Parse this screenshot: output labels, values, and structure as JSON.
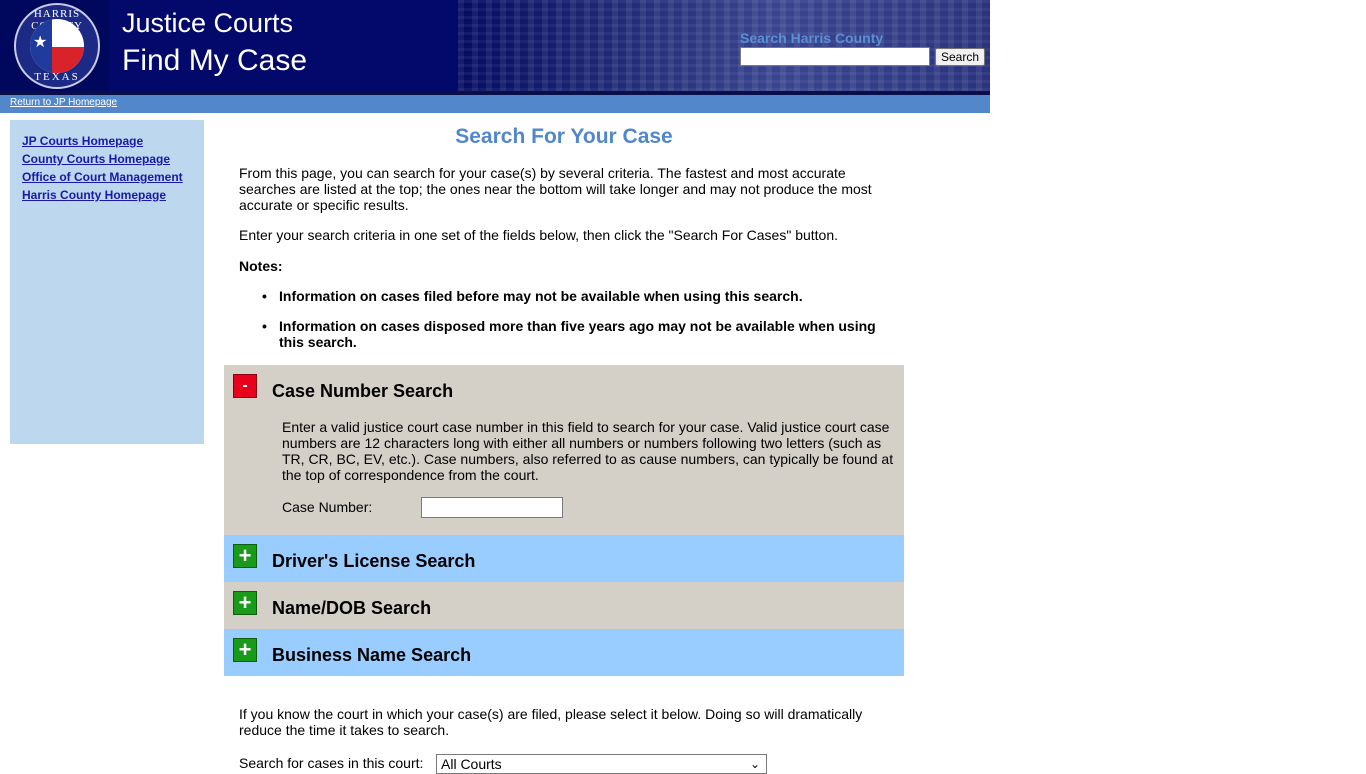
{
  "header": {
    "seal": {
      "top_text": "HARRIS COUNTY",
      "bottom_text": "TEXAS"
    },
    "title_line1": "Justice Courts",
    "title_line2": "Find My Case",
    "search_label": "Search Harris County",
    "search_value": "",
    "search_button": "Search"
  },
  "nav": {
    "return_link": "Return to JP Homepage"
  },
  "sidebar": {
    "items": [
      {
        "label": "JP Courts Homepage"
      },
      {
        "label": "County Courts Homepage"
      },
      {
        "label": "Office of Court Management"
      },
      {
        "label": "Harris County Homepage"
      }
    ]
  },
  "main": {
    "title": "Search For Your Case",
    "intro": "From this page, you can search for your case(s) by several criteria. The fastest and most accurate searches are listed at the top; the ones near the bottom will take longer and may not produce the most accurate or specific results.",
    "instruction": "Enter your search criteria in one set of the fields below, then click the \"Search For Cases\" button.",
    "notes_title": "Notes:",
    "notes": [
      "Information on cases filed before may not be available when using this search.",
      "Information on cases disposed more than five years ago may not be available when using this search."
    ],
    "sections": {
      "case_number": {
        "title": "Case Number Search",
        "toggle": "-",
        "description": "Enter a valid justice court case number in this field to search for your case. Valid justice court case numbers are 12 characters long with either all numbers or numbers following two letters (such as TR, CR, BC, EV, etc.). Case numbers, also referred to as cause numbers, can typically be found at the top of correspondence from the court.",
        "field_label": "Case Number:",
        "field_value": ""
      },
      "drivers_license": {
        "title": "Driver's License Search",
        "toggle": "+"
      },
      "name_dob": {
        "title": "Name/DOB Search",
        "toggle": "+"
      },
      "business_name": {
        "title": "Business Name Search",
        "toggle": "+"
      }
    },
    "court_text": "If you know the court in which your case(s) are filed, please select it below. Doing so will dramatically reduce the time it takes to search.",
    "court_label": "Search for cases in this court:",
    "court_selected": "All Courts"
  },
  "colors": {
    "header_bg": "#00085e",
    "nav_bar": "#5287cc",
    "sidebar_bg": "#bdd7ee",
    "title_blue": "#5287cc",
    "section_tan": "#d4d0c8",
    "section_blue": "#99ccff",
    "toggle_minus": "#e8001c",
    "toggle_plus": "#1a9a1a"
  }
}
